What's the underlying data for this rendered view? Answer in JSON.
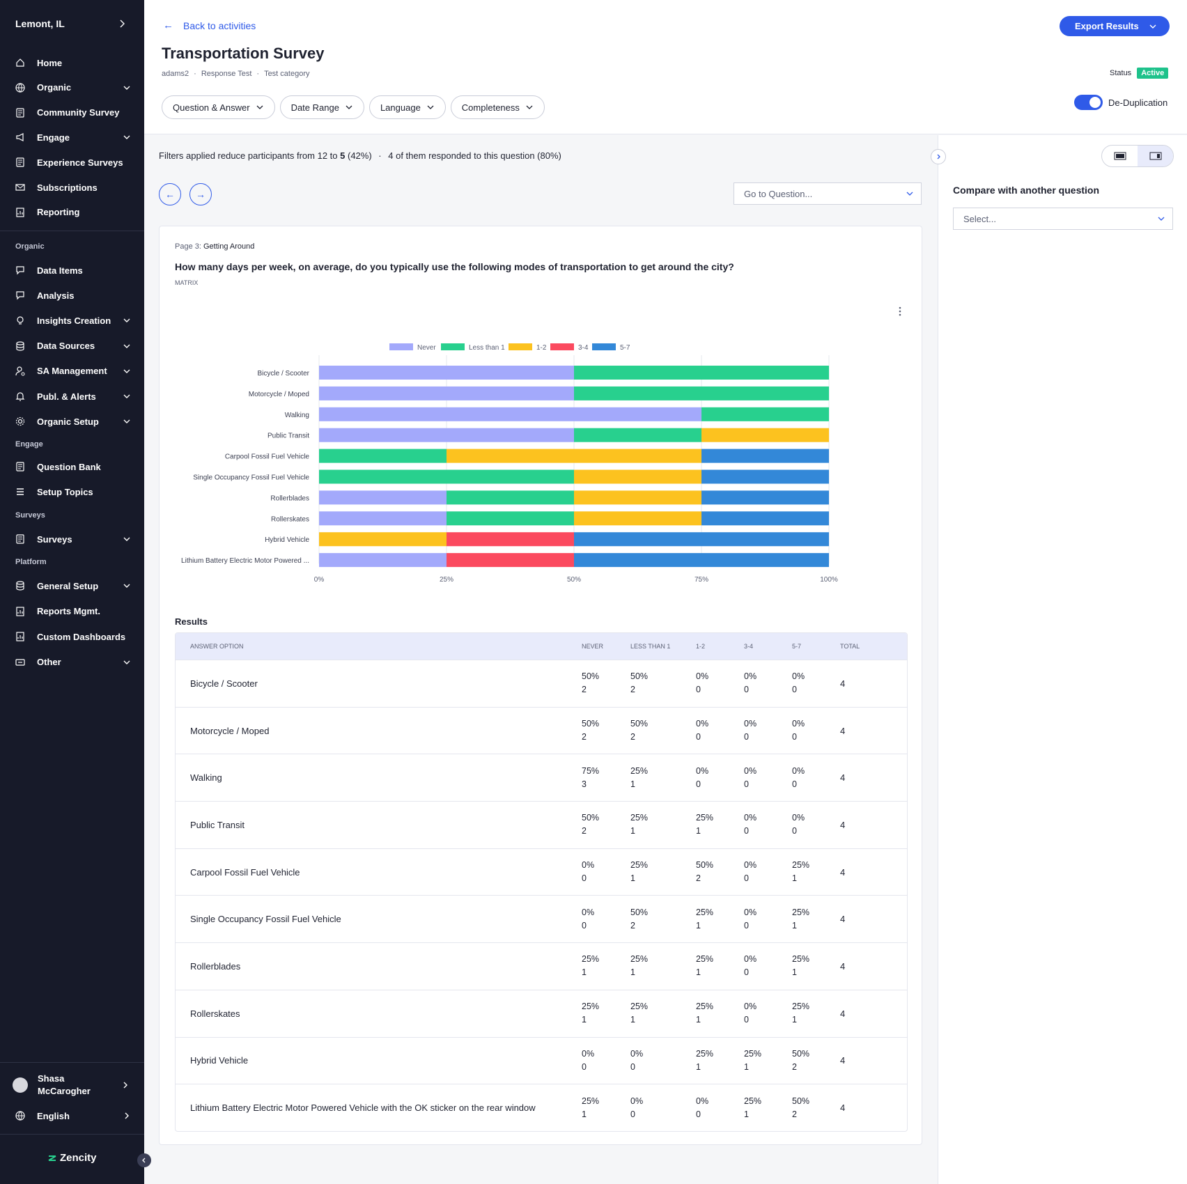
{
  "sidebar": {
    "city": "Lemont, IL",
    "items_top": [
      {
        "label": "Home",
        "icon": "home-icon",
        "has_chevron": false
      },
      {
        "label": "Organic",
        "icon": "globe-icon",
        "has_chevron": true
      },
      {
        "label": "Community Survey",
        "icon": "survey-icon",
        "has_chevron": false
      },
      {
        "label": "Engage",
        "icon": "megaphone-icon",
        "has_chevron": true
      },
      {
        "label": "Experience Surveys",
        "icon": "survey-icon",
        "has_chevron": false
      },
      {
        "label": "Subscriptions",
        "icon": "mail-icon",
        "has_chevron": false
      },
      {
        "label": "Reporting",
        "icon": "report-icon",
        "has_chevron": false
      }
    ],
    "section_organic": "Organic",
    "items_organic": [
      {
        "label": "Data Items",
        "icon": "chat-icon",
        "has_chevron": false
      },
      {
        "label": "Analysis",
        "icon": "chat-icon",
        "has_chevron": false
      },
      {
        "label": "Insights Creation",
        "icon": "bulb-icon",
        "has_chevron": true
      },
      {
        "label": "Data Sources",
        "icon": "database-icon",
        "has_chevron": true
      },
      {
        "label": "SA Management",
        "icon": "user-gear-icon",
        "has_chevron": true
      },
      {
        "label": "Publ. & Alerts",
        "icon": "bell-icon",
        "has_chevron": true
      },
      {
        "label": "Organic Setup",
        "icon": "gear-icon",
        "has_chevron": true
      }
    ],
    "section_engage": "Engage",
    "items_engage": [
      {
        "label": "Question Bank",
        "icon": "survey-icon",
        "has_chevron": false
      },
      {
        "label": "Setup Topics",
        "icon": "list-icon",
        "has_chevron": false
      }
    ],
    "section_surveys": "Surveys",
    "items_surveys": [
      {
        "label": "Surveys",
        "icon": "survey-icon",
        "has_chevron": true
      }
    ],
    "section_platform": "Platform",
    "items_platform": [
      {
        "label": "General Setup",
        "icon": "database-icon",
        "has_chevron": true
      },
      {
        "label": "Reports Mgmt.",
        "icon": "report-icon",
        "has_chevron": false
      },
      {
        "label": "Custom Dashboards",
        "icon": "report-icon",
        "has_chevron": false
      },
      {
        "label": "Other",
        "icon": "other-icon",
        "has_chevron": true
      }
    ],
    "user_name": "Shasa McCarogher",
    "language": "English",
    "logo": "Zencity"
  },
  "header": {
    "back_label": "Back to activities",
    "title": "Transportation Survey",
    "meta": [
      "adams2",
      "Response Test",
      "Test category"
    ],
    "export_label": "Export Results",
    "status_label": "Status",
    "status_value": "Active",
    "filters": [
      "Question & Answer",
      "Date Range",
      "Language",
      "Completeness"
    ],
    "dedup_label": "De-Duplication",
    "dedup_on": true
  },
  "info": {
    "prefix": "Filters applied reduce participants from 12 to ",
    "filtered": "5",
    "pct": " (42%)",
    "sep": "·",
    "responded": "4 of them responded to this question (80%)"
  },
  "goto_placeholder": "Go to Question...",
  "question": {
    "page_prefix": "Page 3:",
    "page_name": "Getting Around",
    "text": "How many days per week, on average, do you typically use the following modes of transportation to get around the city?",
    "type": "MATRIX"
  },
  "chart_data": {
    "type": "bar",
    "orientation": "horizontal",
    "stacked": true,
    "percent": true,
    "legend_position": "top",
    "grid": true,
    "categories": [
      "Bicycle / Scooter",
      "Motorcycle / Moped",
      "Walking",
      "Public Transit",
      "Carpool Fossil Fuel Vehicle",
      "Single Occupancy Fossil Fuel Vehicle",
      "Rollerblades",
      "Rollerskates",
      "Hybrid Vehicle",
      "Lithium Battery Electric Motor Powered ..."
    ],
    "series": [
      {
        "name": "Never",
        "color": "#a3a9fb",
        "values": [
          50,
          50,
          75,
          50,
          0,
          0,
          25,
          25,
          0,
          25
        ]
      },
      {
        "name": "Less than 1",
        "color": "#28d08e",
        "values": [
          50,
          50,
          25,
          25,
          25,
          50,
          25,
          25,
          0,
          0
        ]
      },
      {
        "name": "1-2",
        "color": "#fcc21f",
        "values": [
          0,
          0,
          0,
          25,
          50,
          25,
          25,
          25,
          25,
          0
        ]
      },
      {
        "name": "3-4",
        "color": "#fb4a5f",
        "values": [
          0,
          0,
          0,
          0,
          0,
          0,
          0,
          0,
          25,
          25
        ]
      },
      {
        "name": "5-7",
        "color": "#3388d8",
        "values": [
          0,
          0,
          0,
          0,
          25,
          25,
          25,
          25,
          50,
          50
        ]
      }
    ],
    "xticks": [
      "0%",
      "25%",
      "50%",
      "75%",
      "100%"
    ],
    "xlim": [
      0,
      100
    ]
  },
  "results": {
    "label": "Results",
    "headers": [
      "ANSWER OPTION",
      "NEVER",
      "LESS THAN 1",
      "1-2",
      "3-4",
      "5-7",
      "TOTAL"
    ],
    "rows": [
      {
        "option": "Bicycle / Scooter",
        "cells": [
          [
            "50%",
            "2"
          ],
          [
            "50%",
            "2"
          ],
          [
            "0%",
            "0"
          ],
          [
            "0%",
            "0"
          ],
          [
            "0%",
            "0"
          ]
        ],
        "total": "4"
      },
      {
        "option": "Motorcycle / Moped",
        "cells": [
          [
            "50%",
            "2"
          ],
          [
            "50%",
            "2"
          ],
          [
            "0%",
            "0"
          ],
          [
            "0%",
            "0"
          ],
          [
            "0%",
            "0"
          ]
        ],
        "total": "4"
      },
      {
        "option": "Walking",
        "cells": [
          [
            "75%",
            "3"
          ],
          [
            "25%",
            "1"
          ],
          [
            "0%",
            "0"
          ],
          [
            "0%",
            "0"
          ],
          [
            "0%",
            "0"
          ]
        ],
        "total": "4"
      },
      {
        "option": "Public Transit",
        "cells": [
          [
            "50%",
            "2"
          ],
          [
            "25%",
            "1"
          ],
          [
            "25%",
            "1"
          ],
          [
            "0%",
            "0"
          ],
          [
            "0%",
            "0"
          ]
        ],
        "total": "4"
      },
      {
        "option": "Carpool Fossil Fuel Vehicle",
        "cells": [
          [
            "0%",
            "0"
          ],
          [
            "25%",
            "1"
          ],
          [
            "50%",
            "2"
          ],
          [
            "0%",
            "0"
          ],
          [
            "25%",
            "1"
          ]
        ],
        "total": "4"
      },
      {
        "option": "Single Occupancy Fossil Fuel Vehicle",
        "cells": [
          [
            "0%",
            "0"
          ],
          [
            "50%",
            "2"
          ],
          [
            "25%",
            "1"
          ],
          [
            "0%",
            "0"
          ],
          [
            "25%",
            "1"
          ]
        ],
        "total": "4"
      },
      {
        "option": "Rollerblades",
        "cells": [
          [
            "25%",
            "1"
          ],
          [
            "25%",
            "1"
          ],
          [
            "25%",
            "1"
          ],
          [
            "0%",
            "0"
          ],
          [
            "25%",
            "1"
          ]
        ],
        "total": "4"
      },
      {
        "option": "Rollerskates",
        "cells": [
          [
            "25%",
            "1"
          ],
          [
            "25%",
            "1"
          ],
          [
            "25%",
            "1"
          ],
          [
            "0%",
            "0"
          ],
          [
            "25%",
            "1"
          ]
        ],
        "total": "4"
      },
      {
        "option": "Hybrid Vehicle",
        "cells": [
          [
            "0%",
            "0"
          ],
          [
            "0%",
            "0"
          ],
          [
            "25%",
            "1"
          ],
          [
            "25%",
            "1"
          ],
          [
            "50%",
            "2"
          ]
        ],
        "total": "4"
      },
      {
        "option": "Lithium Battery Electric Motor Powered Vehicle with the OK sticker on the rear window",
        "cells": [
          [
            "25%",
            "1"
          ],
          [
            "0%",
            "0"
          ],
          [
            "0%",
            "0"
          ],
          [
            "25%",
            "1"
          ],
          [
            "50%",
            "2"
          ]
        ],
        "total": "4"
      }
    ]
  },
  "compare": {
    "title": "Compare with another question",
    "placeholder": "Select..."
  }
}
